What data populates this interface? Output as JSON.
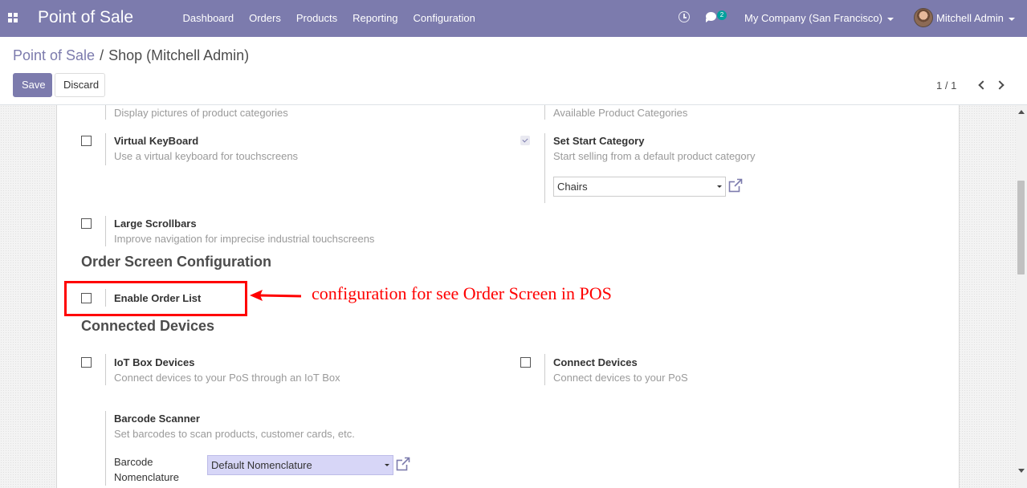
{
  "navbar": {
    "brand": "Point of Sale",
    "menu": [
      "Dashboard",
      "Orders",
      "Products",
      "Reporting",
      "Configuration"
    ],
    "chat_count": "2",
    "company": "My Company (San Francisco)",
    "user": "Mitchell Admin",
    "accent_color": "#7c7bad"
  },
  "control": {
    "breadcrumb_root": "Point of Sale",
    "breadcrumb_sep": "/",
    "breadcrumb_current": "Shop (Mitchell Admin)",
    "save_label": "Save",
    "discard_label": "Discard",
    "pager": "1 / 1"
  },
  "settings": {
    "categories_pictures_desc": "Display pictures of product categories",
    "available_categories_desc": "Available Product Categories",
    "virtual_keyboard": {
      "title": "Virtual KeyBoard",
      "desc": "Use a virtual keyboard for touchscreens",
      "checked": false
    },
    "start_category": {
      "title": "Set Start Category",
      "desc": "Start selling from a default product category",
      "checked": true,
      "value": "Chairs"
    },
    "large_scrollbars": {
      "title": "Large Scrollbars",
      "desc": "Improve navigation for imprecise industrial touchscreens",
      "checked": false
    }
  },
  "order_screen": {
    "section_title": "Order Screen Configuration",
    "enable_order_list": {
      "title": "Enable Order List",
      "checked": false
    }
  },
  "annotation": {
    "text": "configuration for see Order Screen in POS",
    "color": "#ff0000"
  },
  "devices": {
    "section_title": "Connected Devices",
    "iot_box": {
      "title": "IoT Box Devices",
      "desc": "Connect devices to your PoS through an IoT Box",
      "checked": false
    },
    "connect": {
      "title": "Connect Devices",
      "desc": "Connect devices to your PoS",
      "checked": false
    },
    "barcode": {
      "title": "Barcode Scanner",
      "desc": "Set barcodes to scan products, customer cards, etc.",
      "nomenclature_label_1": "Barcode",
      "nomenclature_label_2": "Nomenclature",
      "nomenclature_value": "Default Nomenclature"
    }
  }
}
